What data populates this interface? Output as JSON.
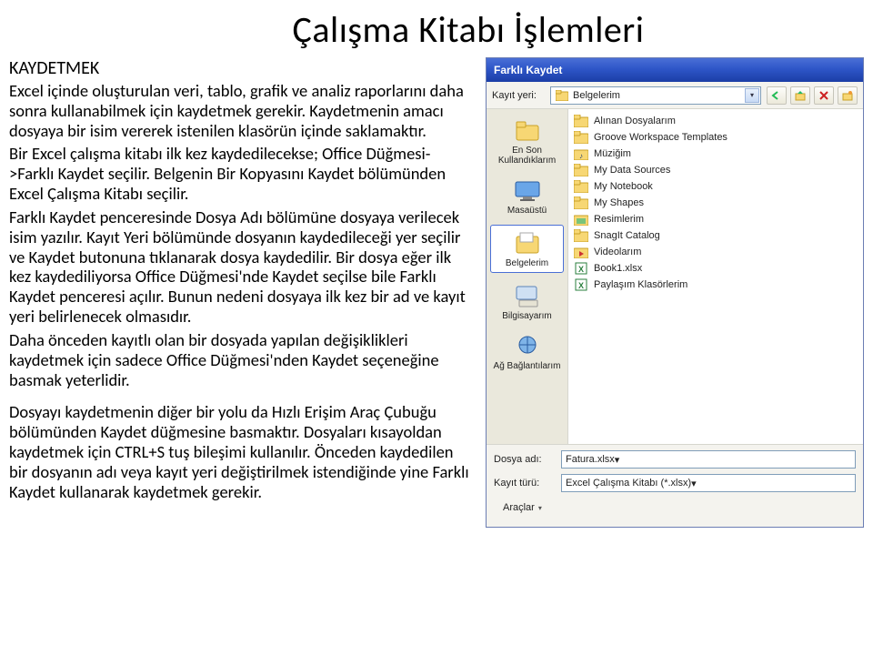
{
  "title": "Çalışma Kitabı İşlemleri",
  "section_heading": "KAYDETMEK",
  "para1": "Excel içinde oluşturulan veri, tablo, grafik ve analiz raporlarını daha sonra kullanabilmek için kaydetmek gerekir. Kaydetmenin amacı dosyaya bir isim vererek istenilen klasörün içinde saklamaktır.",
  "para2": "Bir Excel çalışma kitabı ilk kez kaydedilecekse; Office Düğmesi->Farklı Kaydet seçilir. Belgenin Bir Kopyasını Kaydet bölümünden Excel Çalışma Kitabı seçilir.",
  "para3": "Farklı Kaydet penceresinde Dosya Adı bölümüne dosyaya verilecek isim yazılır. Kayıt Yeri bölümünde dosyanın kaydedileceği yer seçilir ve Kaydet butonuna tıklanarak dosya kaydedilir. Bir dosya eğer ilk kez kaydediliyorsa Office Düğmesi'nde Kaydet seçilse bile Farklı Kaydet penceresi açılır. Bunun nedeni dosyaya ilk kez bir ad ve kayıt yeri belirlenecek olmasıdır.",
  "para4": "Daha önceden kayıtlı olan bir dosyada yapılan değişiklikleri kaydetmek için sadece Office Düğmesi'nden Kaydet seçeneğine basmak yeterlidir.",
  "para5": "Dosyayı kaydetmenin diğer bir yolu da Hızlı Erişim Araç Çubuğu bölümünden Kaydet düğmesine basmaktır. Dosyaları kısayoldan kaydetmek için CTRL+S tuş bileşimi kullanılır. Önceden kaydedilen bir dosyanın adı veya kayıt yeri değiştirilmek istendiğinde yine Farklı Kaydet kullanarak kaydetmek gerekir.",
  "dialog": {
    "title": "Farklı Kaydet",
    "save_in_label": "Kayıt yeri:",
    "save_in_value": "Belgelerim",
    "places": [
      {
        "label": "En Son Kullandıklarım",
        "icon": "folder-recent"
      },
      {
        "label": "Masaüstü",
        "icon": "desktop"
      },
      {
        "label": "Belgelerim",
        "icon": "my-documents",
        "selected": true
      },
      {
        "label": "Bilgisayarım",
        "icon": "computer"
      },
      {
        "label": "Ağ Bağlantılarım",
        "icon": "network"
      }
    ],
    "files": [
      {
        "label": "Alınan Dosyalarım",
        "icon": "folder"
      },
      {
        "label": "Groove Workspace Templates",
        "icon": "folder"
      },
      {
        "label": "Müziğim",
        "icon": "folder-music"
      },
      {
        "label": "My Data Sources",
        "icon": "folder-data"
      },
      {
        "label": "My Notebook",
        "icon": "folder"
      },
      {
        "label": "My Shapes",
        "icon": "folder"
      },
      {
        "label": "Resimlerim",
        "icon": "folder-pictures"
      },
      {
        "label": "SnagIt Catalog",
        "icon": "folder"
      },
      {
        "label": "Videolarım",
        "icon": "folder-video"
      },
      {
        "label": "Book1.xlsx",
        "icon": "excel"
      },
      {
        "label": "Paylaşım Klasörlerim",
        "icon": "excel-share"
      }
    ],
    "filename_label": "Dosya adı:",
    "filename_value": "Fatura.xlsx",
    "filetype_label": "Kayıt türü:",
    "filetype_value": "Excel Çalışma Kitabı (*.xlsx)",
    "tools_label": "Araçlar"
  }
}
